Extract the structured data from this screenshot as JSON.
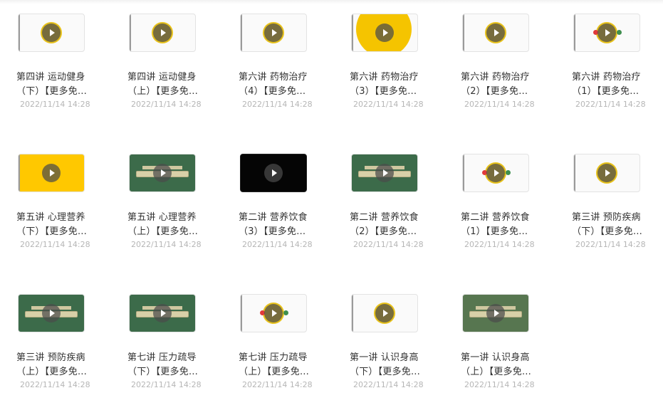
{
  "play_icon": "play-icon",
  "videos": [
    {
      "line1": "第四讲 运动健身",
      "line2": "（下）【更多免…",
      "date": "2022/11/14 14:28",
      "thumb": {
        "bg": "#fafafa",
        "style": "light",
        "accent": "#e8c21a"
      }
    },
    {
      "line1": "第四讲 运动健身",
      "line2": "（上）【更多免…",
      "date": "2022/11/14 14:28",
      "thumb": {
        "bg": "#fafafa",
        "style": "light",
        "accent": "#e8c21a"
      }
    },
    {
      "line1": "第六讲 药物治疗",
      "line2": "（4）【更多免…",
      "date": "2022/11/14 14:28",
      "thumb": {
        "bg": "#fafafa",
        "style": "light",
        "accent": "#e8c21a"
      }
    },
    {
      "line1": "第六讲 药物治疗",
      "line2": "（3）【更多免…",
      "date": "2022/11/14 14:28",
      "thumb": {
        "bg": "#fafafa",
        "style": "yellow-circle",
        "accent": "#f5c400"
      }
    },
    {
      "line1": "第六讲 药物治疗",
      "line2": "（2）【更多免…",
      "date": "2022/11/14 14:28",
      "thumb": {
        "bg": "#fafafa",
        "style": "light",
        "accent": "#e8c21a"
      }
    },
    {
      "line1": "第六讲 药物治疗",
      "line2": "（1）【更多免…",
      "date": "2022/11/14 14:28",
      "thumb": {
        "bg": "#fafafa",
        "style": "light-dots",
        "accent": "#e8c21a"
      }
    },
    {
      "line1": "第五讲 心理营养",
      "line2": "（下）【更多免…",
      "date": "2022/11/14 14:28",
      "thumb": {
        "bg": "#ffc800",
        "style": "yellow",
        "accent": "#ffc800"
      }
    },
    {
      "line1": "第五讲 心理营养",
      "line2": "（上）【更多免…",
      "date": "2022/11/14 14:28",
      "thumb": {
        "bg": "#3c6b4a",
        "style": "board",
        "accent": "#3c6b4a"
      }
    },
    {
      "line1": "第二讲 营养饮食",
      "line2": "（3）【更多免…",
      "date": "2022/11/14 14:28",
      "thumb": {
        "bg": "#050505",
        "style": "black",
        "accent": "#050505"
      }
    },
    {
      "line1": "第二讲 营养饮食",
      "line2": "（2）【更多免…",
      "date": "2022/11/14 14:28",
      "thumb": {
        "bg": "#3c6b4a",
        "style": "board",
        "accent": "#3c6b4a"
      }
    },
    {
      "line1": "第二讲 营养饮食",
      "line2": "（1）【更多免…",
      "date": "2022/11/14 14:28",
      "thumb": {
        "bg": "#fafafa",
        "style": "light-dots",
        "accent": "#e8c21a"
      }
    },
    {
      "line1": "第三讲 预防疾病",
      "line2": "（下）【更多免…",
      "date": "2022/11/14 14:28",
      "thumb": {
        "bg": "#fafafa",
        "style": "light",
        "accent": "#e8c21a"
      }
    },
    {
      "line1": "第三讲 预防疾病",
      "line2": "（上）【更多免…",
      "date": "2022/11/14 14:28",
      "thumb": {
        "bg": "#3c6b4a",
        "style": "board",
        "accent": "#3c6b4a"
      }
    },
    {
      "line1": "第七讲 压力疏导",
      "line2": "（下）【更多免…",
      "date": "2022/11/14 14:28",
      "thumb": {
        "bg": "#3c6b4a",
        "style": "board",
        "accent": "#3c6b4a"
      }
    },
    {
      "line1": "第七讲 压力疏导",
      "line2": "（上）【更多免…",
      "date": "2022/11/14 14:28",
      "thumb": {
        "bg": "#fafafa",
        "style": "light-dots",
        "accent": "#e8c21a"
      }
    },
    {
      "line1": "第一讲 认识身高",
      "line2": "（下）【更多免…",
      "date": "2022/11/14 14:28",
      "thumb": {
        "bg": "#fafafa",
        "style": "light",
        "accent": "#e8c21a"
      }
    },
    {
      "line1": "第一讲 认识身高",
      "line2": "（上）【更多免…",
      "date": "2022/11/14 14:28",
      "thumb": {
        "bg": "#577650",
        "style": "board",
        "accent": "#577650"
      }
    }
  ]
}
